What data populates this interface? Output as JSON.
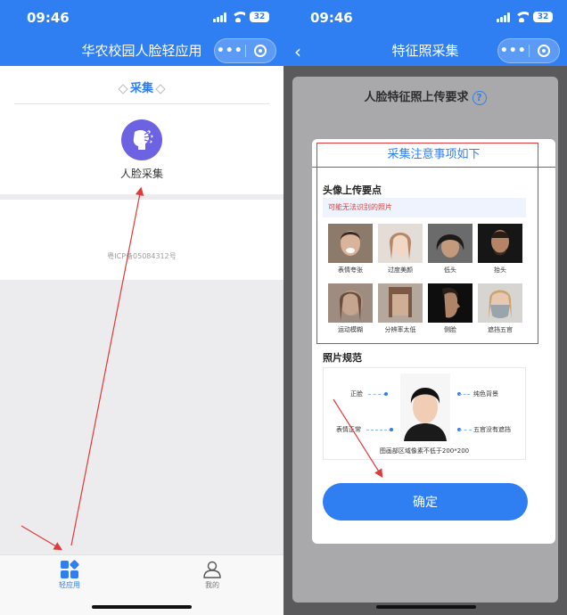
{
  "left_screen": {
    "status": {
      "time": "09:46",
      "battery": "32"
    },
    "nav": {
      "title": "华农校园人脸轻应用",
      "more_label": "•••"
    },
    "section": {
      "title": "采集"
    },
    "app_item": {
      "label": "人脸采集"
    },
    "icp": "粤ICP备05084312号",
    "tabs": [
      {
        "label": "轻应用",
        "icon": "grid-icon",
        "active": true
      },
      {
        "label": "我的",
        "icon": "user-icon",
        "active": false
      }
    ]
  },
  "right_screen": {
    "status": {
      "time": "09:46",
      "battery": "32"
    },
    "nav": {
      "title": "特征照采集",
      "more_label": "•••"
    },
    "background_page": {
      "title": "人脸特征照上传要求",
      "help_icon": "?"
    },
    "modal": {
      "title": "采集注意事项如下",
      "section_title": "头像上传要点",
      "warning": "可能无法识别的照片",
      "photos": [
        {
          "label": "表情夸张"
        },
        {
          "label": "过度美颜"
        },
        {
          "label": "低头"
        },
        {
          "label": "抬头"
        },
        {
          "label": "运动模糊"
        },
        {
          "label": "分辨率太低"
        },
        {
          "label": "侧脸"
        },
        {
          "label": "遮挡五官"
        }
      ],
      "spec_title": "照片规范",
      "spec_labels": {
        "front_face": "正脸",
        "neutral_expression": "表情正常",
        "plain_background": "纯色背景",
        "no_occlusion": "五官没有遮挡",
        "resolution_note": "图画部区域像素不低于200*200"
      },
      "confirm_label": "确定"
    }
  },
  "colors": {
    "primary_blue": "#2f7ff2",
    "annotation_red": "#e03a3a",
    "app_icon_purple": "#6d63e2"
  }
}
